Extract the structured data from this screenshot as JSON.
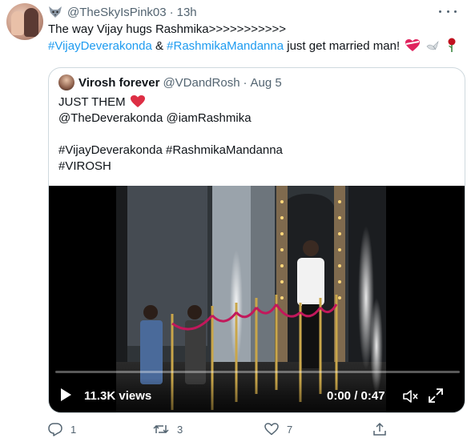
{
  "author": {
    "handle": "@TheSkyIsPink03",
    "time": "13h",
    "avatar_icon": "user-avatar"
  },
  "tweet": {
    "line1": "The way Vijay hugs Rashmika>>>>>>>>>>>",
    "hashtag1": "#VijayDeverakonda",
    "amp": " & ",
    "hashtag2": "#RashmikaMandanna",
    "tail": " just get married man!",
    "emojis": [
      "wrapped-heart-emoji",
      "dove-emoji",
      "rose-emoji"
    ]
  },
  "quote": {
    "name": "Virosh forever",
    "handle": "@VDandRosh",
    "sep": "·",
    "date": "Aug 5",
    "lines": [
      "JUST THEM",
      "@TheDeverakonda @iamRashmika",
      "",
      "#VijayDeverakonda #RashmikaMandanna",
      "#VIROSH"
    ],
    "heart_icon": "red-heart-emoji"
  },
  "video": {
    "views": "11.3K views",
    "time": "0:00 / 0:47",
    "progress": 0
  },
  "actions": {
    "reply": "1",
    "retweet": "3",
    "like": "7"
  },
  "colors": {
    "link": "#1d9bf0",
    "secondary": "#536471",
    "border": "#cfd9de"
  }
}
